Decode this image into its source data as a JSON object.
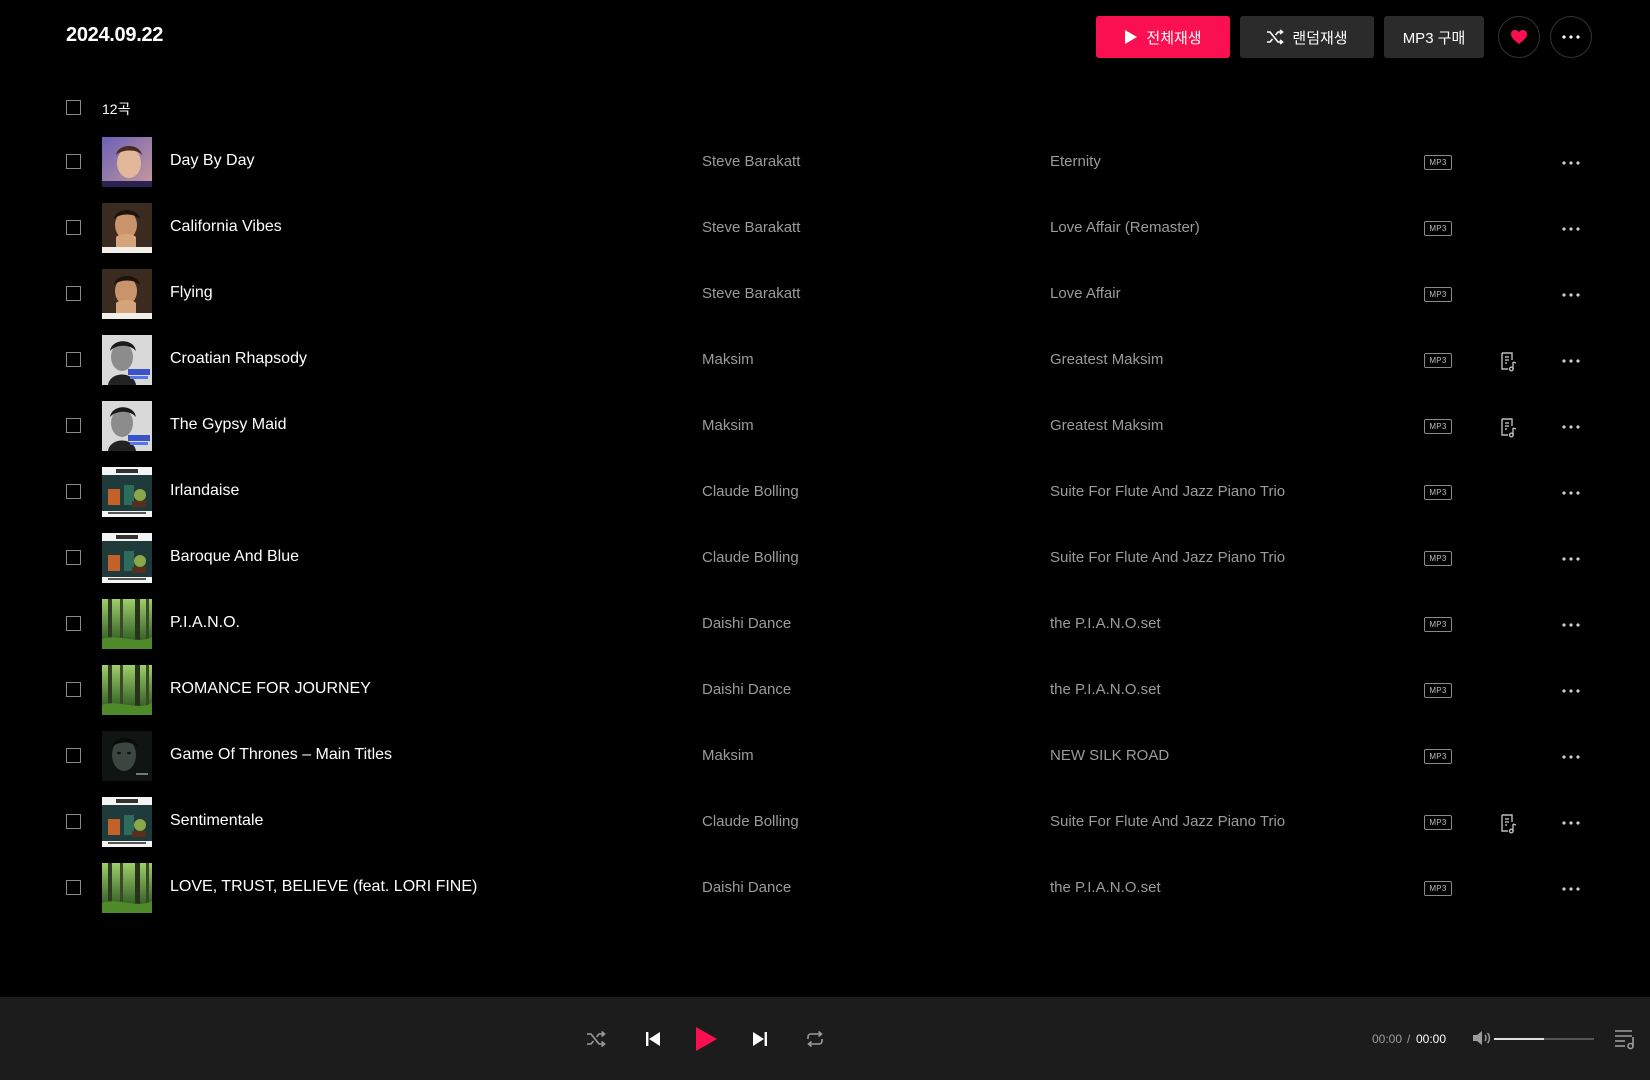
{
  "header": {
    "title": "2024.09.22",
    "play_all_label": "전체재생",
    "shuffle_label": "랜덤재생",
    "mp3_label": "MP3 구매"
  },
  "colors": {
    "accent": "#fa0f50",
    "background": "#000000",
    "player_bg": "#1c1c1c",
    "button_bg": "#2b2b2b",
    "muted_text": "#9b9b9b"
  },
  "list": {
    "count_label": "12곡",
    "badge_label": "MP3",
    "tracks": [
      {
        "title": "Day By Day",
        "artist": "Steve Barakatt",
        "album": "Eternity",
        "lyrics": false,
        "art": "portrait-purple"
      },
      {
        "title": "California Vibes",
        "artist": "Steve Barakatt",
        "album": "Love Affair (Remaster)",
        "lyrics": false,
        "art": "portrait-warm"
      },
      {
        "title": "Flying",
        "artist": "Steve Barakatt",
        "album": "Love Affair",
        "lyrics": false,
        "art": "portrait-warm"
      },
      {
        "title": "Croatian Rhapsody",
        "artist": "Maksim",
        "album": "Greatest Maksim",
        "lyrics": true,
        "art": "portrait-bw"
      },
      {
        "title": "The Gypsy Maid",
        "artist": "Maksim",
        "album": "Greatest Maksim",
        "lyrics": true,
        "art": "portrait-bw"
      },
      {
        "title": "Irlandaise",
        "artist": "Claude Bolling",
        "album": "Suite For Flute And Jazz Piano Trio",
        "lyrics": false,
        "art": "jazz-cover"
      },
      {
        "title": "Baroque And Blue",
        "artist": "Claude Bolling",
        "album": "Suite For Flute And Jazz Piano Trio",
        "lyrics": false,
        "art": "jazz-cover"
      },
      {
        "title": "P.I.A.N.O.",
        "artist": "Daishi Dance",
        "album": "the P.I.A.N.O.set",
        "lyrics": false,
        "art": "forest"
      },
      {
        "title": "ROMANCE FOR JOURNEY",
        "artist": "Daishi Dance",
        "album": "the P.I.A.N.O.set",
        "lyrics": false,
        "art": "forest"
      },
      {
        "title": "Game Of Thrones – Main Titles",
        "artist": "Maksim",
        "album": "NEW SILK ROAD",
        "lyrics": false,
        "art": "dark-face"
      },
      {
        "title": "Sentimentale",
        "artist": "Claude Bolling",
        "album": "Suite For Flute And Jazz Piano Trio",
        "lyrics": true,
        "art": "jazz-cover"
      },
      {
        "title": "LOVE, TRUST, BELIEVE (feat. LORI FINE)",
        "artist": "Daishi Dance",
        "album": "the P.I.A.N.O.set",
        "lyrics": false,
        "art": "forest"
      }
    ]
  },
  "player": {
    "time_current": "00:00",
    "time_separator": "/",
    "time_total": "00:00",
    "volume": 0.5
  }
}
